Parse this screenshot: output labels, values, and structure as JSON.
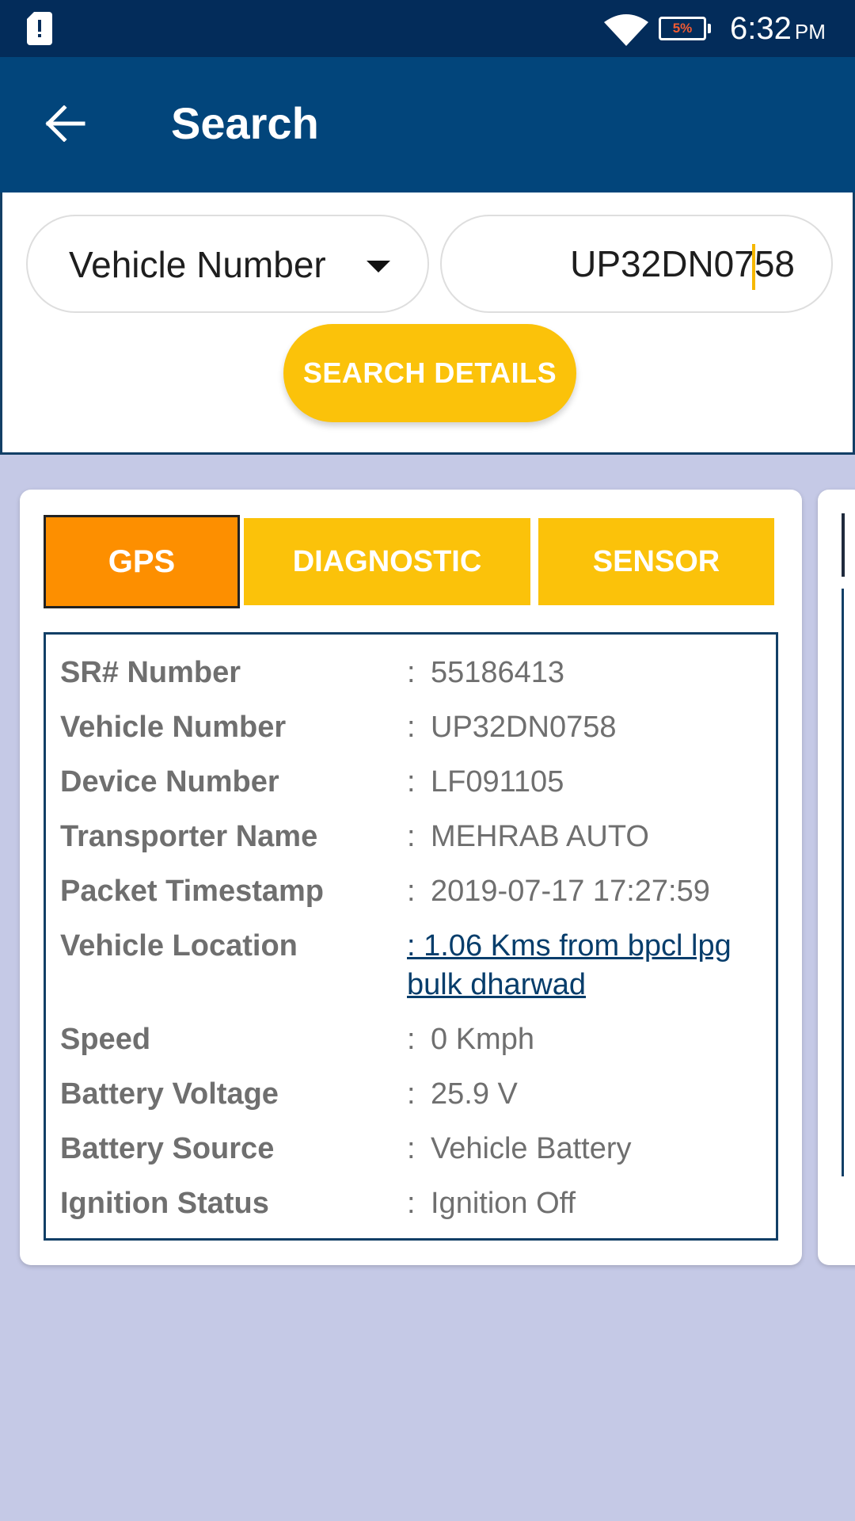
{
  "status_bar": {
    "notification_icon": "sim-alert-icon",
    "wifi_icon": "wifi-icon",
    "battery_percent": "5%",
    "time": "6:32",
    "ampm": "PM"
  },
  "app_bar": {
    "back_icon": "arrow-left-icon",
    "title": "Search"
  },
  "search": {
    "dropdown_selected": "Vehicle Number",
    "input_value": "UP32DN0758",
    "button_label": "SEARCH DETAILS"
  },
  "tabs": [
    {
      "label": "GPS",
      "active": true
    },
    {
      "label": "DIAGNOSTIC",
      "active": false
    },
    {
      "label": "SENSOR",
      "active": false
    }
  ],
  "details": [
    {
      "label": "SR# Number",
      "value": "55186413"
    },
    {
      "label": "Vehicle Number",
      "value": "UP32DN0758"
    },
    {
      "label": "Device Number",
      "value": "LF091105"
    },
    {
      "label": "Transporter Name",
      "value": "MEHRAB AUTO"
    },
    {
      "label": "Packet Timestamp",
      "value": "2019-07-17 17:27:59"
    },
    {
      "label": "Vehicle Location",
      "value": ":  1.06 Kms from bpcl lpg bulk dharwad",
      "is_link": true
    },
    {
      "label": "Speed",
      "value": "0 Kmph"
    },
    {
      "label": "Battery Voltage",
      "value": "25.9 V"
    },
    {
      "label": "Battery Source",
      "value": "Vehicle Battery"
    },
    {
      "label": "Ignition Status",
      "value": "Ignition Off"
    }
  ],
  "colors": {
    "status_bar": "#032c5a",
    "app_bar": "#02457b",
    "accent_yellow": "#fbc20a",
    "active_tab_orange": "#fd8f00",
    "background": "#c5c9e6",
    "link": "#063d6b",
    "battery_low": "#f05a32"
  }
}
